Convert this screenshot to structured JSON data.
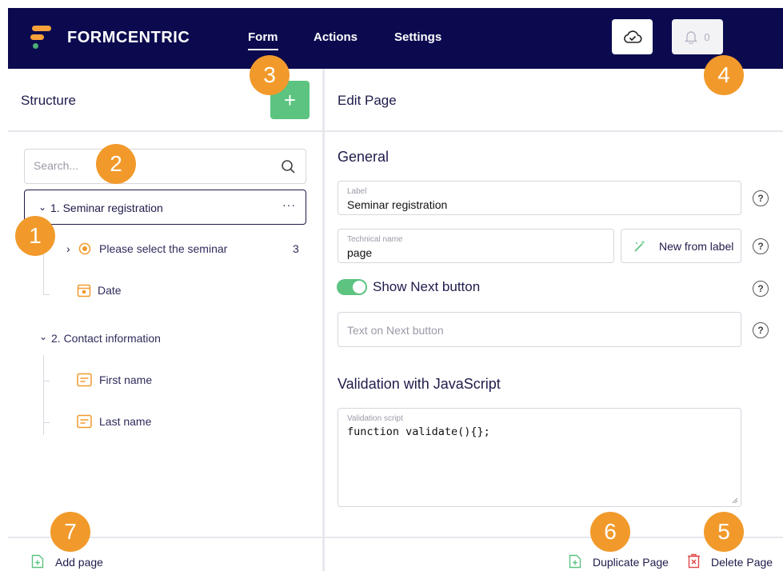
{
  "topbar": {
    "brand": "FORMCENTRIC",
    "nav": [
      "Form",
      "Actions",
      "Settings"
    ],
    "notification_count": "0",
    "icons": {
      "save": "cloud-check-icon",
      "notifications": "bell-icon"
    },
    "colors": {
      "background": "#0b0a4f",
      "logo_orange": "#f6a13a",
      "logo_green": "#4caf76"
    }
  },
  "structure": {
    "title": "Structure",
    "add_label": "+",
    "search_placeholder": "Search...",
    "pages": [
      {
        "label": "1. Seminar registration",
        "more": "···",
        "items": [
          {
            "label": "Please select the seminar",
            "count": "3",
            "icon": "radio-icon"
          },
          {
            "label": "Date",
            "icon": "calendar-icon"
          }
        ]
      },
      {
        "label": "2. Contact information",
        "items": [
          {
            "label": "First name",
            "icon": "text-field-icon"
          },
          {
            "label": "Last name",
            "icon": "text-field-icon"
          }
        ]
      }
    ],
    "add_page_label": "Add page"
  },
  "edit": {
    "title": "Edit Page",
    "general_title": "General",
    "label_field": {
      "label": "Label",
      "value": "Seminar registration"
    },
    "technical_field": {
      "label": "Technical name",
      "value": "page"
    },
    "new_from_label": "New from label",
    "show_next_label": "Show Next button",
    "show_next_on": true,
    "next_text_placeholder": "Text on Next button",
    "validation_title": "Validation with JavaScript",
    "script_field": {
      "label": "Validation script",
      "value": "function validate(){};"
    },
    "help_label": "?",
    "duplicate_label": "Duplicate Page",
    "delete_label": "Delete Page"
  },
  "callouts": [
    "1",
    "2",
    "3",
    "4",
    "5",
    "6",
    "7"
  ],
  "colors": {
    "accent_green": "#5cc380",
    "callout_orange": "#f19a2b",
    "delete_red": "#e04848"
  }
}
